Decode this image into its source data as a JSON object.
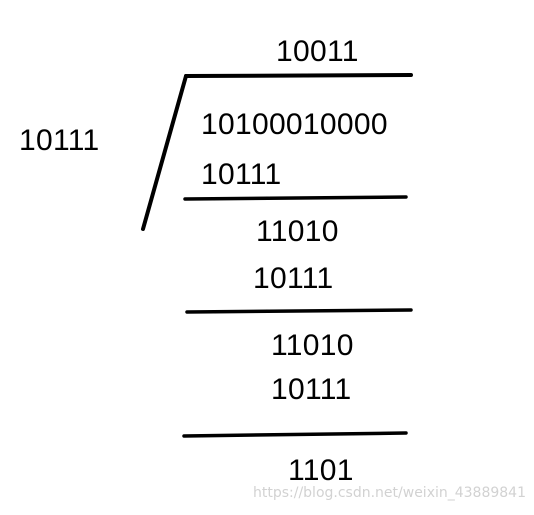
{
  "division": {
    "divisor": "10111",
    "quotient": "10011",
    "dividend": "10100010000",
    "steps": [
      {
        "subtrahend": "10111",
        "remainder": "11010"
      },
      {
        "subtrahend": "10111",
        "remainder": "11010"
      },
      {
        "subtrahend": "10111",
        "remainder": "1101"
      }
    ]
  },
  "watermark": "https://blog.csdn.net/weixin_43889841"
}
